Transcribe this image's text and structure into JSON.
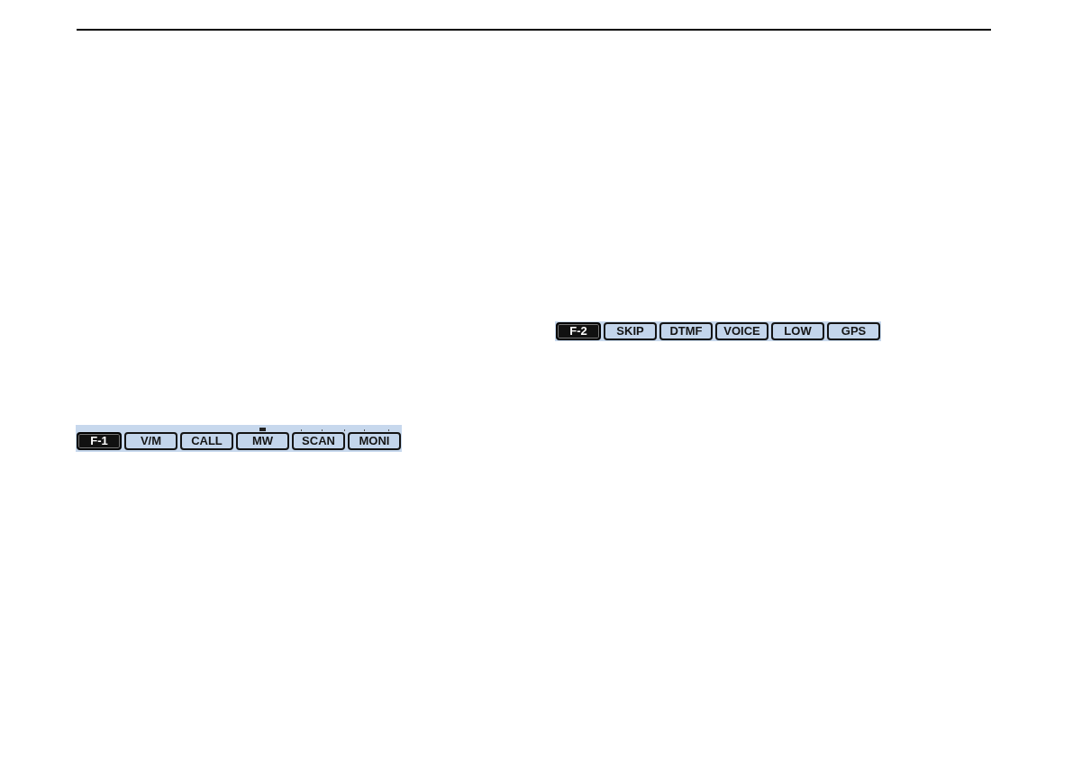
{
  "function_bars": [
    {
      "scale_visible": true,
      "keys": [
        {
          "label": "F-1",
          "kind": "indicator"
        },
        {
          "label": "V/M",
          "kind": "key"
        },
        {
          "label": "CALL",
          "kind": "key"
        },
        {
          "label": "MW",
          "kind": "key"
        },
        {
          "label": "SCAN",
          "kind": "key"
        },
        {
          "label": "MONI",
          "kind": "key"
        }
      ]
    },
    {
      "scale_visible": false,
      "keys": [
        {
          "label": "F-2",
          "kind": "indicator"
        },
        {
          "label": "SKIP",
          "kind": "key"
        },
        {
          "label": "DTMF",
          "kind": "key"
        },
        {
          "label": "VOICE",
          "kind": "key"
        },
        {
          "label": "LOW",
          "kind": "key"
        },
        {
          "label": "GPS",
          "kind": "key"
        }
      ]
    }
  ]
}
